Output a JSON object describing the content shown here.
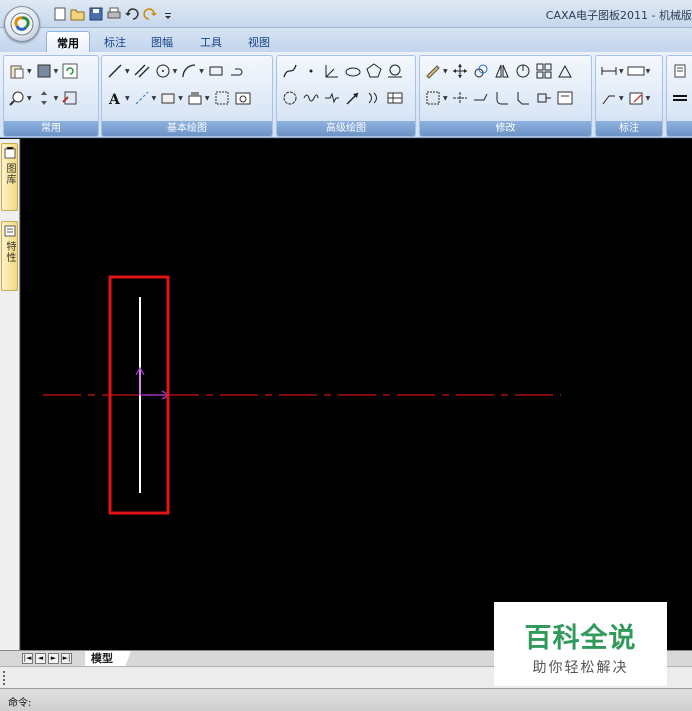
{
  "window": {
    "title": "CAXA电子图板2011 - 机械版"
  },
  "ribbon": {
    "tabs": [
      {
        "label": "常用",
        "active": true
      },
      {
        "label": "标注"
      },
      {
        "label": "图幅"
      },
      {
        "label": "工具"
      },
      {
        "label": "视图"
      }
    ],
    "groups": {
      "common": "常用",
      "basic_draw": "基本绘图",
      "advanced_draw": "高级绘图",
      "modify": "修改",
      "annotate": "标注"
    }
  },
  "side_panel": {
    "library_tab": "图库",
    "properties_tab": "特性"
  },
  "layout_tabs": {
    "model_tab": "模型"
  },
  "command_line": {
    "prompt": "命令:"
  },
  "watermark": {
    "title": "百科全说",
    "subtitle": "助你轻松解决"
  },
  "colors": {
    "canvas_bg": "#000000",
    "centerline": "#cc1010",
    "highlight_box": "#e01414",
    "axis_marker": "#b040e0",
    "watermark_green": "#2f9a59"
  }
}
